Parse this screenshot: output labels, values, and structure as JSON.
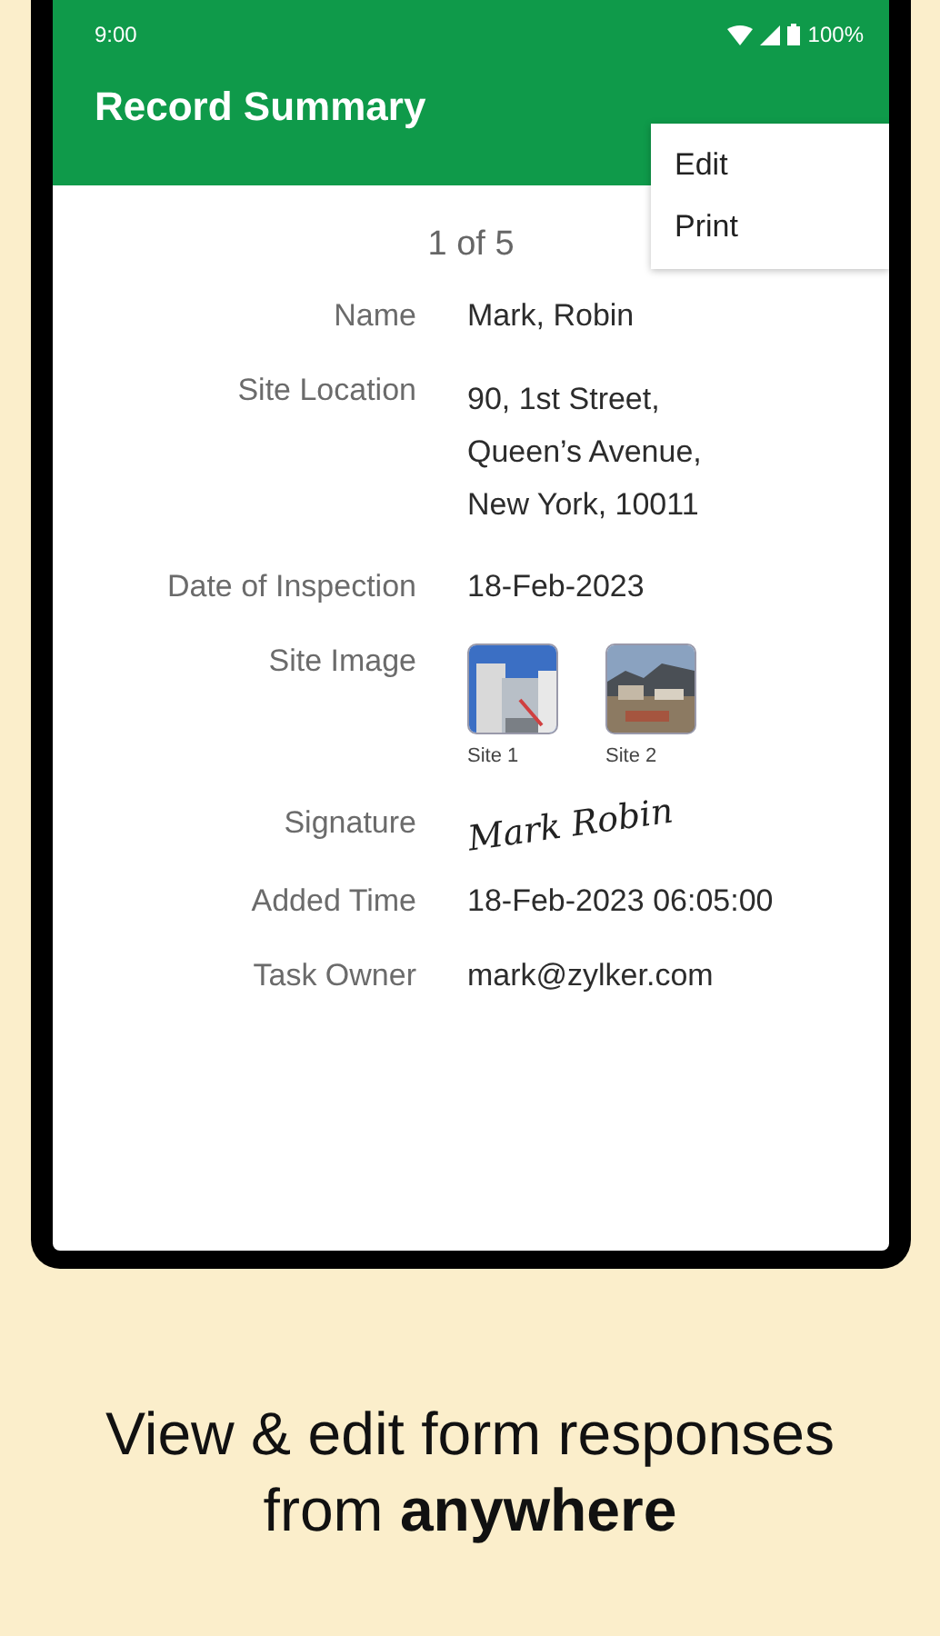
{
  "status_bar": {
    "time": "9:00",
    "battery": "100%"
  },
  "app_bar": {
    "title": "Record Summary"
  },
  "menu": {
    "items": [
      "Edit",
      "Print"
    ]
  },
  "pager": "1 of 5",
  "fields": [
    {
      "kind": "text",
      "label": "Name",
      "value": "Mark, Robin"
    },
    {
      "kind": "multiline",
      "label": "Site Location",
      "lines": [
        "90, 1st Street,",
        "Queen’s Avenue,",
        "New York, 10011"
      ]
    },
    {
      "kind": "text",
      "label": "Date of Inspection",
      "value": "18-Feb-2023"
    },
    {
      "kind": "images",
      "label": "Site Image",
      "images": [
        {
          "kind": "picture",
          "caption": "Site 1"
        },
        {
          "kind": "picture",
          "caption": "Site 2"
        }
      ]
    },
    {
      "kind": "signature",
      "label": "Signature",
      "value": "Mark Robin"
    },
    {
      "kind": "text",
      "label": "Added Time",
      "value": "18-Feb-2023 06:05:00"
    },
    {
      "kind": "text",
      "label": "Task Owner",
      "value": "mark@zylker.com"
    }
  ],
  "caption": {
    "lines": [
      "View & edit form responses",
      "from **anywhere**"
    ]
  }
}
